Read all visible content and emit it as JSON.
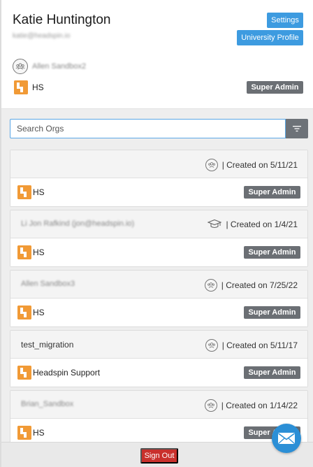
{
  "user": {
    "name": "Katie Huntington",
    "email": "katie@headspin.io"
  },
  "header_buttons": {
    "settings": "Settings",
    "university_profile": "University Profile"
  },
  "current": {
    "group_name": "Allen Sandbox2",
    "org": "HS",
    "role": "Super Admin"
  },
  "search": {
    "placeholder": "Search Orgs"
  },
  "orgs": [
    {
      "name": "",
      "icon": "group-icon",
      "created": "| Created on 5/11/21",
      "org": "HS",
      "role": "Super Admin"
    },
    {
      "name": "Li Jon Rafkind (jon@headspin.io)",
      "icon": "graduation-cap-icon",
      "created": "| Created on 1/4/21",
      "org": "HS",
      "role": "Super Admin"
    },
    {
      "name": "Allen Sandbox3",
      "icon": "group-icon",
      "created": "| Created on 7/25/22",
      "org": "HS",
      "role": "Super Admin"
    },
    {
      "name": "test_migration",
      "icon": "group-icon",
      "created": "| Created on 5/11/17",
      "org": "Headspin Support",
      "role": "Super Admin"
    },
    {
      "name": "Brian_Sandbox",
      "icon": "group-icon",
      "created": "| Created on 1/14/22",
      "org": "HS",
      "role": "Super Admin"
    }
  ],
  "footer": {
    "sign_out": "Sign Out"
  },
  "colors": {
    "primary_blue": "#3d9be0",
    "badge_gray": "#6b6f74",
    "sign_out_red": "#c9302c",
    "logo_orange": "#f19a36"
  }
}
